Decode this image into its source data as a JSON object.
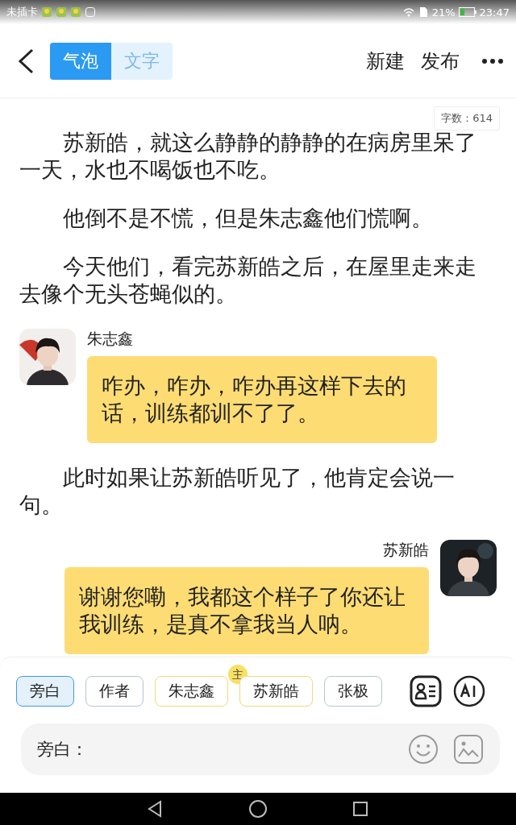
{
  "status_bar": {
    "carrier": "未插卡",
    "battery_text": "21%",
    "time": "23:47"
  },
  "header": {
    "modes": [
      {
        "label": "气泡",
        "selected": true
      },
      {
        "label": "文字",
        "selected": false
      }
    ],
    "actions": [
      "新建",
      "发布"
    ]
  },
  "word_count": "字数：614",
  "story": [
    {
      "kind": "narration",
      "text": "苏新皓，就这么静静的静静的在病房里呆了一天，水也不喝饭也不吃。"
    },
    {
      "kind": "narration",
      "text": "他倒不是不慌，但是朱志鑫他们慌啊。"
    },
    {
      "kind": "narration",
      "text": "今天他们，看完苏新皓之后，在屋里走来走去像个无头苍蝇似的。"
    },
    {
      "kind": "left_dialog",
      "speaker": "朱志鑫",
      "text": "咋办，咋办，咋办再这样下去的话，训练都训不了了。"
    },
    {
      "kind": "narration",
      "text": "此时如果让苏新皓听见了，他肯定会说一句。"
    },
    {
      "kind": "right_dialog",
      "speaker": "苏新皓",
      "text": "谢谢您嘞，我都这个样子了你还让我训练，是真不拿我当人呐。"
    }
  ],
  "roles": [
    {
      "label": "旁白",
      "selected": true,
      "color": "#3d9bf0"
    },
    {
      "label": "作者",
      "selected": false,
      "color": "#b8c4d6"
    },
    {
      "label": "朱志鑫",
      "selected": false,
      "color": "#f5d77a"
    },
    {
      "label": "苏新皓",
      "selected": false,
      "color": "#f5d77a",
      "badge": "主"
    },
    {
      "label": "张极",
      "selected": false,
      "color": "#b8c4d6"
    }
  ],
  "input": {
    "placeholder": "旁白："
  }
}
